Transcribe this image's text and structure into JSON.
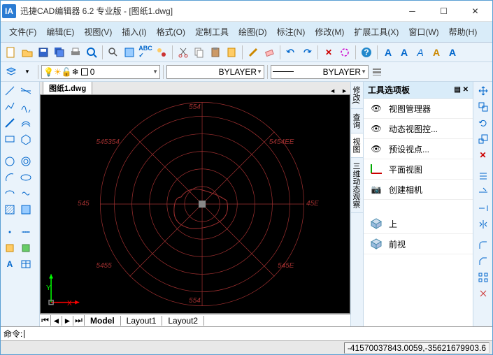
{
  "title": "迅捷CAD编辑器 6.2 专业版  - [图纸1.dwg]",
  "logo_text": "IA",
  "menus": [
    "文件(F)",
    "编辑(E)",
    "视图(V)",
    "插入(I)",
    "格式(O)",
    "定制工具",
    "绘图(D)",
    "标注(N)",
    "修改(M)",
    "扩展工具(X)",
    "窗口(W)",
    "帮助(H)"
  ],
  "toolbar2": {
    "layer_color": "0",
    "linetype": "BYLAYER",
    "lineweight": "BYLAYER"
  },
  "text_tools": [
    "A",
    "A",
    "A",
    "A",
    "A"
  ],
  "doc_tab": "图纸1.dwg",
  "bottom_tabs": {
    "model": "Model",
    "layout1": "Layout1",
    "layout2": "Layout2"
  },
  "right_panel": {
    "title": "工具选项板",
    "vtabs": [
      "修改(",
      "查询",
      "视图",
      "三维动态观察"
    ],
    "items": [
      {
        "icon": "eye",
        "label": "视图管理器"
      },
      {
        "icon": "eye-rot",
        "label": "动态视图控..."
      },
      {
        "icon": "eye-arrow",
        "label": "预设视点..."
      },
      {
        "icon": "axes",
        "label": "平面视图"
      },
      {
        "icon": "camera",
        "label": "创建相机"
      },
      {
        "icon": "cube",
        "label": "上"
      },
      {
        "icon": "cube",
        "label": "前视"
      }
    ]
  },
  "cmd_prompt": "命令:",
  "coords": "-41570037843.0059,-35621679903.6",
  "compass": {
    "N": "554",
    "NE": "5454EE",
    "E": "45E",
    "SE": "545E",
    "S": "554",
    "SW": "5455",
    "W": "545",
    "NW": "545354"
  },
  "axis": {
    "y": "Y",
    "x": "X"
  },
  "chart_data": {
    "type": "polar-grid",
    "description": "CAD drawing viewport showing a red polar/compass grid centered on canvas with 8 radial spokes (N,NE,E,SE,S,SW,W,NW), 6 concentric circles, and an irregular closed red polyline near center. Green Y axis arrow and red X axis arrow at lower-left origin indicator.",
    "rings": 6,
    "spokes": 8,
    "center": [
      280,
      175
    ],
    "outer_radius": 150
  }
}
